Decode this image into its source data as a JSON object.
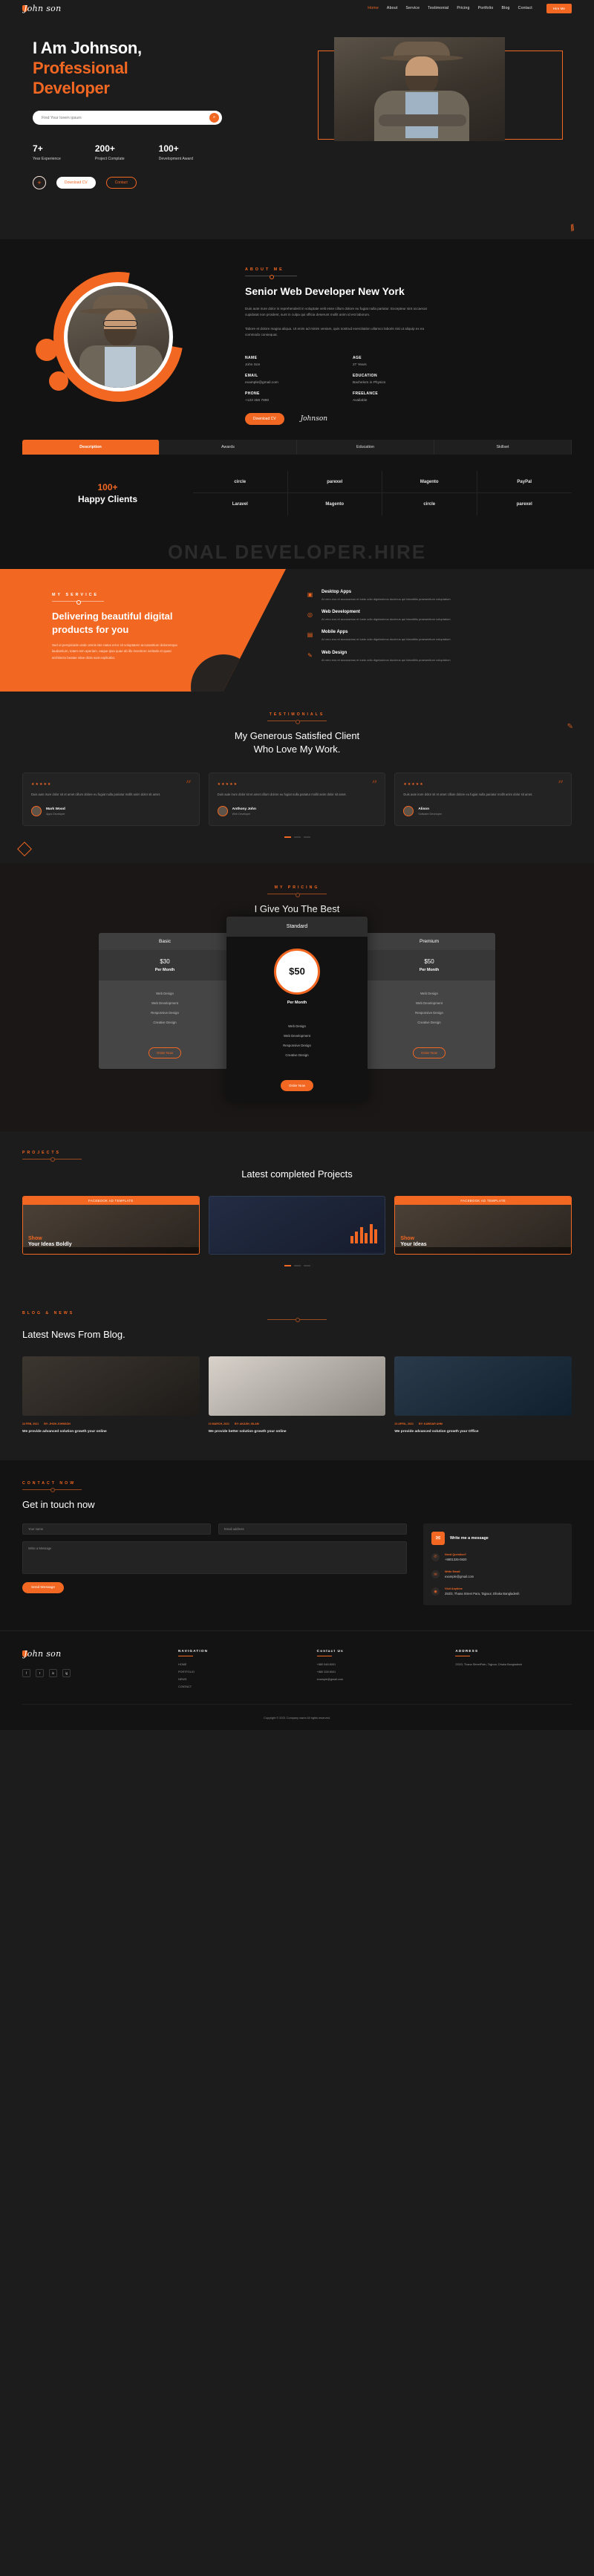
{
  "brand": {
    "name": "John son",
    "accent": "#f26722",
    "bg": "#1c1c1c"
  },
  "nav": {
    "items": [
      {
        "label": "Home",
        "active": true
      },
      {
        "label": "About",
        "active": false
      },
      {
        "label": "Service",
        "active": false
      },
      {
        "label": "Testimonial",
        "active": false
      },
      {
        "label": "Pricing",
        "active": false
      },
      {
        "label": "Portfolio",
        "active": false
      },
      {
        "label": "Blog",
        "active": false
      },
      {
        "label": "Contact",
        "active": false
      }
    ],
    "cta": "Hire Me"
  },
  "hero": {
    "title_line1": "I Am Johnson,",
    "title_line2": "Professional",
    "title_line3": "Developer",
    "search_placeholder": "Find Your lorem ipsum",
    "search_icon": "search-icon",
    "stats": [
      {
        "num": "7",
        "plus": "+",
        "label": "Year Experience"
      },
      {
        "num": "200",
        "plus": "+",
        "label": "Project Complate"
      },
      {
        "num": "100",
        "plus": "+",
        "label": "Development Award"
      }
    ],
    "plus_icon": "+",
    "btn_download": "Download CV",
    "btn_contact": "Contact"
  },
  "about": {
    "eyebrow": "ABOUT ME",
    "title": "Senior Web Developer New York",
    "para1": "Duis aute irure dolor in reprehenderit in voluptate velit esse cillum dolore eu fugiat nulla pariatur. Excepteur sint occaecat cupidatat non proident, sunt in culpa qui officia deserunt mollit anim id est laborum.",
    "para2": "Tabore et dolore magna aliqua. Ut enim ad minim veniam, quis nostrud exercitation ullamco laboris nisi ut aliquip ex ea commodo consequat.",
    "fields_left": [
      {
        "k": "NAME",
        "v": "John Son"
      },
      {
        "k": "EMAIL",
        "v": "example@gmail.com"
      },
      {
        "k": "PHONE",
        "v": "+123 456 7890"
      }
    ],
    "fields_right": [
      {
        "k": "AGE",
        "v": "27 Years"
      },
      {
        "k": "EDUCATION",
        "v": "Bachelors in Physics"
      },
      {
        "k": "FREELANCE",
        "v": "Available"
      }
    ],
    "btn": "Download CV",
    "signature": "Johnson",
    "tabs": [
      {
        "label": "Description",
        "active": true
      },
      {
        "label": "Awards",
        "active": false
      },
      {
        "label": "Education",
        "active": false
      },
      {
        "label": "Skillset",
        "active": false
      }
    ],
    "clients_num": "100+",
    "clients_label": "Happy Clients",
    "logos": [
      "circle",
      "parexel",
      "Magento",
      "PayPal",
      "Laravel",
      "Magento",
      "circle",
      "parexel"
    ]
  },
  "watermark": "ONAL DEVELOPER.HIRE",
  "service": {
    "eyebrow": "MY SERVICE",
    "title": "Delivering beautiful digital products for you",
    "para": "Sed ut perspiciatis unde omnis iste natus error sit voluptatem accusantium doloremque laudantium, totam rem aperiam, eaque ipsa quae ab illo inventore veritatis et quasi architecto beatae vitae dicta sunt explicabo.",
    "items": [
      {
        "icon": "desktop-icon",
        "title": "Desktop Apps",
        "desc": "At vero eos et accusamus et iusto odio dignissimos ducimus qui blanditiis praesentium voluptatum"
      },
      {
        "icon": "code-icon",
        "title": "Web Development",
        "desc": "At vero eos et accusamus et iusto odio dignissimos ducimus qui blanditiis praesentium voluptatum"
      },
      {
        "icon": "mobile-icon",
        "title": "Mobile Apps",
        "desc": "At vero eos et accusamus et iusto odio dignissimos ducimus qui blanditiis praesentium voluptatum"
      },
      {
        "icon": "pen-icon",
        "title": "Web Design",
        "desc": "At vero eos et accusamus et iusto odio dignissimos ducimus qui blanditiis praesentium voluptatum"
      }
    ]
  },
  "testimonials": {
    "eyebrow": "TESTIMONIALS",
    "title_line1": "My Generous Satisfied Client",
    "title_line2": "Who Love My Work.",
    "stars": "★★★★★",
    "quote_glyph": "”",
    "cards": [
      {
        "text": "Duis aute irure dolor sit et amet cillum dolore eu fugiat nulla pariatur mollit anim dolor sit amet.",
        "name": "Mark Wood",
        "role": "Apps Developer"
      },
      {
        "text": "Duis aute irure dolor sit et amet cillum dolore eu fugiat nulla pariatur mollit anim dolor sit amet.",
        "name": "Anthony John",
        "role": "Web Developer"
      },
      {
        "text": "Duis aute irure dolor sit et amet cillum dolore eu fugiat nulla pariatur mollit anim dolor sit amet.",
        "name": "Alison",
        "role": "Software Developer"
      }
    ]
  },
  "pricing": {
    "eyebrow": "MY PRICING",
    "title": "I Give You The Best",
    "features": [
      "Web Design",
      "Web Development",
      "Responsive Design",
      "Creative Design"
    ],
    "plans": [
      {
        "name": "Basic",
        "price": "$30",
        "per": "Per Month",
        "btn": "Order Now",
        "featured": false
      },
      {
        "name": "Standard",
        "price": "$50",
        "per": "Per Month",
        "btn": "Order Now",
        "featured": true
      },
      {
        "name": "Premium",
        "price": "$50",
        "per": "Per Month",
        "btn": "Order Now",
        "featured": false
      }
    ]
  },
  "projects": {
    "eyebrow": "PROJECTS",
    "title": "Latest completed Projects",
    "cards": [
      {
        "tag": "FACEBOOK AD TEMPLATE",
        "headline_or": "Show",
        "headline_w": "Your Ideas Boldly",
        "style": "photo"
      },
      {
        "tag": "",
        "headline_or": "",
        "headline_w": "",
        "style": "chart"
      },
      {
        "tag": "FACEBOOK AD TEMPLATE",
        "headline_or": "Show",
        "headline_w": "Your Ideas",
        "style": "photo"
      }
    ]
  },
  "blog": {
    "eyebrow": "BLOG & NEWS",
    "title": "Latest News From Blog.",
    "posts": [
      {
        "date": "24 FEB, 2021",
        "by": "BY: JHON JOHNSON",
        "title": "We provide advanced solution growth your online"
      },
      {
        "date": "10 MARCH, 2021",
        "by": "BY: AKASH, ISLAM",
        "title": "We provide better solution growth your online"
      },
      {
        "date": "23 APRIL, 2021",
        "by": "BY: KAWSAR AHM",
        "title": "We provide advanced solution growth your Office"
      }
    ]
  },
  "contact": {
    "eyebrow": "CONTACT NOW",
    "title": "Get in touch now",
    "name_placeholder": "Your name",
    "email_placeholder": "Email address",
    "message_placeholder": "Write a Message",
    "submit": "Send Message",
    "box_icon": "envelope-icon",
    "box_title": "Write me a message",
    "items": [
      {
        "icon": "phone-icon",
        "k": "Need Question?",
        "v": "+8801326-0820"
      },
      {
        "icon": "mail-icon",
        "k": "Write Email",
        "v": "example@gmail.com"
      },
      {
        "icon": "pin-icon",
        "k": "Visit Anytime",
        "v": "253/3, Thana Street Para, Tajpuur, Dhaka Bangladesh"
      }
    ]
  },
  "footer": {
    "brand": "John son",
    "socials": [
      "f",
      "t",
      "in",
      "ig"
    ],
    "cols": [
      {
        "title": "NAVIGATION",
        "links": [
          "HOME",
          "PORTFOLIO",
          "NEWS",
          "CONTACT"
        ]
      },
      {
        "title": "Contact Us",
        "links": [
          "+880 548 8001",
          "+880 328 8001",
          "example@gmail.com"
        ]
      },
      {
        "title": "ADDRESS",
        "links": [
          "253/3, Thana StreetPatn, Tajpuur, Dhaka Bangladesh"
        ]
      }
    ],
    "copyright": "Copyright © 2021 Company name All rights reserved."
  }
}
